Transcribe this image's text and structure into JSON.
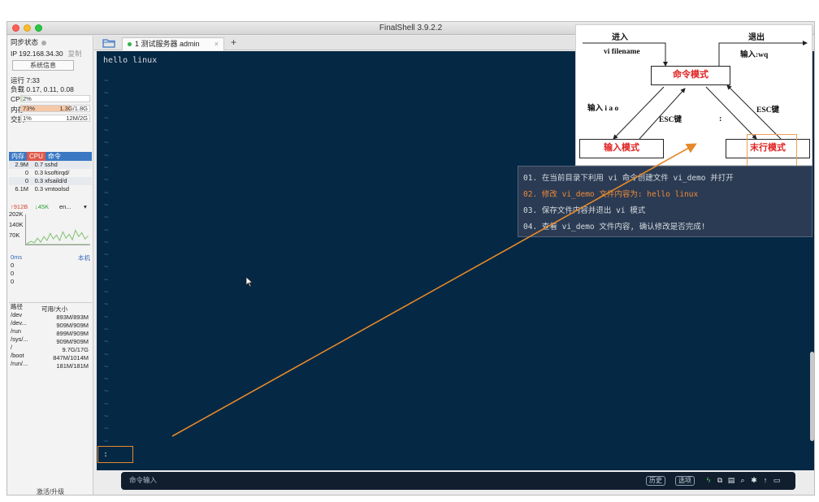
{
  "window": {
    "title": "FinalShell 3.9.2.2"
  },
  "sidebar": {
    "sync_label": "同步状态",
    "ip_label": "IP 192.168.34.30",
    "copy_label": "复制",
    "sysinfo_button": "系统信息",
    "uptime": "运行 7:33",
    "load": "负载 0.17, 0.11, 0.08",
    "cpu_label": "CPU",
    "cpu_value": "2%",
    "cpu_fraction": 0.02,
    "mem_label": "内存",
    "mem_percent": "73%",
    "mem_value": "1.3G/1.8G",
    "mem_fraction": 0.73,
    "swap_label": "交换",
    "swap_percent": "1%",
    "swap_value": "12M/2G",
    "swap_fraction": 0.01,
    "proc_tabs": [
      "内存",
      "CPU",
      "命令"
    ],
    "processes": [
      {
        "mem": "2.9M",
        "cpu": "0.7",
        "cmd": "sshd"
      },
      {
        "mem": "0",
        "cpu": "0.3",
        "cmd": "ksoftirqd/"
      },
      {
        "mem": "0",
        "cpu": "0.3",
        "cmd": "xfsaild/d"
      },
      {
        "mem": "6.1M",
        "cpu": "0.3",
        "cmd": "vmtoolsd"
      }
    ],
    "net_up": "↑912B",
    "net_down": "↓45K",
    "net_iface": "en...",
    "net_ticks": [
      "202K",
      "140K",
      "70K"
    ],
    "latency_label": "0ms",
    "latency_host": "本机",
    "latency_ticks": [
      "0",
      "0",
      "0"
    ],
    "disk_headers": [
      "路径",
      "可用/大小"
    ],
    "disks": [
      {
        "path": "/dev",
        "size": "893M/893M"
      },
      {
        "path": "/dev...",
        "size": "909M/909M"
      },
      {
        "path": "/run",
        "size": "899M/909M"
      },
      {
        "path": "/sys/...",
        "size": "909M/909M"
      },
      {
        "path": "/",
        "size": "9.7G/17G"
      },
      {
        "path": "/boot",
        "size": "847M/1014M"
      },
      {
        "path": "/run/...",
        "size": "181M/181M"
      }
    ],
    "activate": "激活/升级"
  },
  "tabs": [
    {
      "label": "1 测试服务器 admin",
      "close": "×"
    }
  ],
  "tab_add": "+",
  "terminal": {
    "first_line": "hello linux",
    "tilde": "~",
    "prompt": ":"
  },
  "cmdbar": {
    "label": "命令输入",
    "history": "历史",
    "options": "选项"
  },
  "diagram": {
    "enter": "进入",
    "enter_cmd": "vi filename",
    "exit": "退出",
    "exit_cmd": "输入:wq",
    "command_mode": "命令模式",
    "insert_keys": "输入 i a o",
    "esc_left": "ESC键",
    "colon": ":",
    "esc_right": "ESC键",
    "insert_mode": "输入模式",
    "lastline_mode": "末行模式"
  },
  "tasks": [
    "01. 在当前目录下利用 vi 命令创建文件 vi_demo 并打开",
    "02. 修改 vi_demo 文件内容为: hello linux",
    "03. 保存文件内容并退出 vi 模式",
    "04. 查看 vi_demo 文件内容, 确认修改是否完成!"
  ],
  "colors": {
    "terminal_bg": "#052844",
    "accent_orange": "#e6892a",
    "mode_red": "#e02323",
    "task_highlight": "#ef8a3a"
  }
}
